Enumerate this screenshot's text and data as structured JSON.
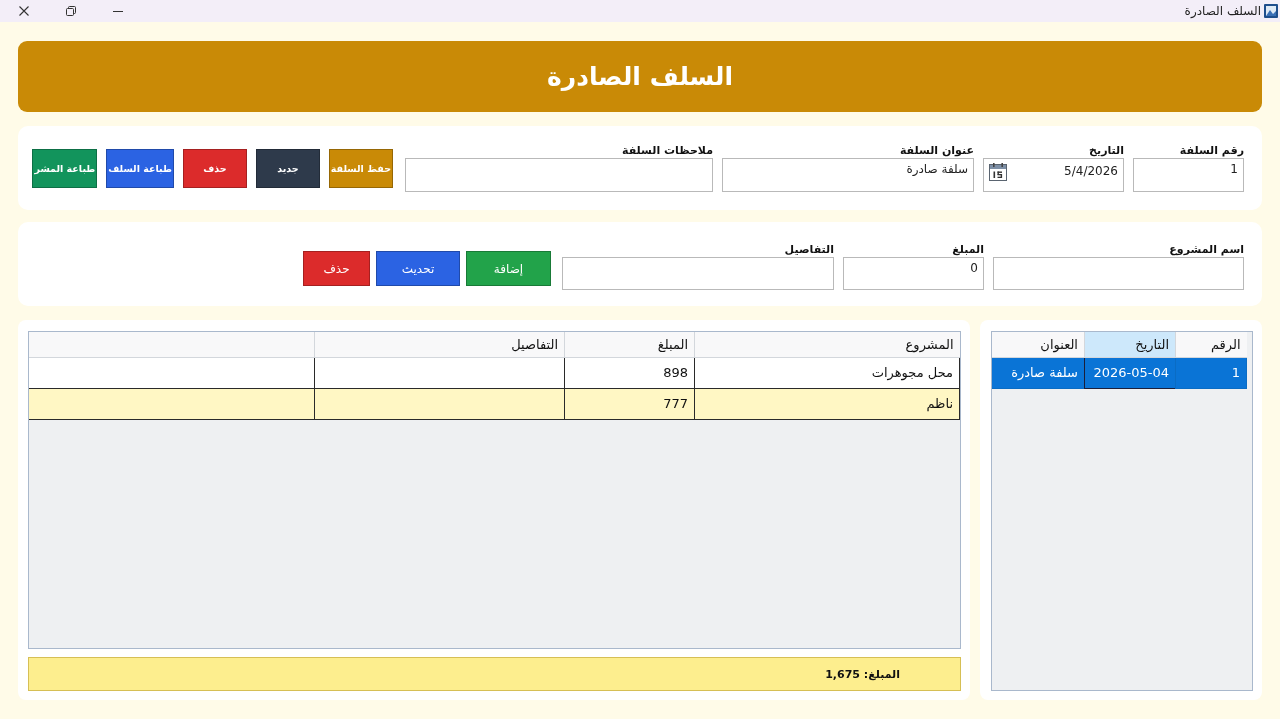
{
  "window": {
    "title": "السلف الصادرة"
  },
  "header": {
    "title": "السلف الصادرة"
  },
  "advance_form": {
    "fields": [
      {
        "kind": "text",
        "label": "رقم السلفة",
        "value": "1"
      },
      {
        "kind": "date",
        "label": "التاريخ",
        "value": "5/4/2026"
      },
      {
        "kind": "text",
        "label": "عنوان السلفة",
        "value": "سلفة صادرة"
      },
      {
        "kind": "text",
        "label": "ملاحظات السلفة"
      }
    ],
    "buttons": [
      {
        "label": "حفظ السلفة",
        "color": "#c98a06"
      },
      {
        "label": "جديد",
        "color": "#2e3a4b"
      },
      {
        "label": "حذف",
        "color": "#dc2b2b"
      },
      {
        "label": "طباعة السلف",
        "color": "#2b63e3"
      },
      {
        "label": "طباعة المشر",
        "color": "#12945c"
      }
    ]
  },
  "project_form": {
    "fields": [
      {
        "kind": "text",
        "label": "اسم المشروع"
      },
      {
        "kind": "text",
        "label": "المبلغ",
        "value": "0"
      },
      {
        "kind": "text",
        "label": "التفاصيل"
      }
    ],
    "buttons": [
      {
        "label": "إضافة",
        "color": "#22a34a"
      },
      {
        "label": "تحديث",
        "color": "#2b63e3"
      },
      {
        "label": "حذف",
        "color": "#dc2b2b"
      }
    ]
  },
  "advances_table": {
    "columns": [
      {
        "label": "الرقم",
        "selected": false
      },
      {
        "label": "التاريخ",
        "selected": true
      },
      {
        "label": "العنوان",
        "selected": false
      }
    ],
    "rows": [
      {
        "selected": true,
        "cells": [
          {
            "text": "1",
            "focused": false
          },
          {
            "text": "2026-05-04",
            "focused": true
          },
          {
            "text": "سلفة صادرة",
            "focused": false
          }
        ]
      }
    ]
  },
  "projects_table": {
    "columns": [
      "المشروع",
      "المبلغ",
      "التفاصيل"
    ],
    "rows": [
      {
        "cells": [
          "محل مجوهرات",
          "898"
        ]
      },
      {
        "cells": [
          "ناظم",
          "777"
        ]
      }
    ]
  },
  "total": "المبلغ: 1,675"
}
